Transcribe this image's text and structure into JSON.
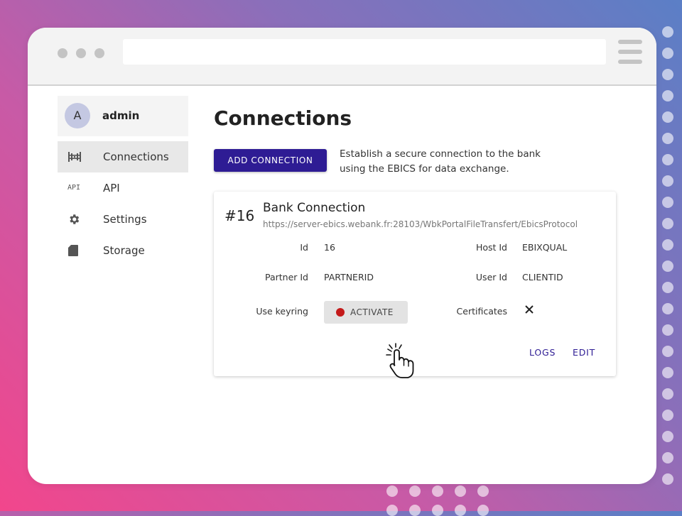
{
  "user": {
    "avatar_letter": "A",
    "name": "admin"
  },
  "nav": {
    "items": [
      {
        "label": "Connections",
        "icon": "connections-icon",
        "active": true
      },
      {
        "label": "API",
        "icon": "api-icon",
        "active": false
      },
      {
        "label": "Settings",
        "icon": "gear-icon",
        "active": false
      },
      {
        "label": "Storage",
        "icon": "sd-card-icon",
        "active": false
      }
    ],
    "api_icon_text": "API"
  },
  "page": {
    "title": "Connections",
    "add_button_label": "ADD CONNECTION",
    "description_line1": "Establish a secure connection to the bank",
    "description_line2": "using the EBICS for data exchange."
  },
  "connection": {
    "number": "#16",
    "title": "Bank Connection",
    "url": "https://server-ebics.webank.fr:28103/WbkPortalFileTransfert/EbicsProtocol",
    "fields": {
      "id_label": "Id",
      "id_value": "16",
      "host_id_label": "Host Id",
      "host_id_value": "EBIXQUAL",
      "partner_id_label": "Partner Id",
      "partner_id_value": "PARTNERID",
      "user_id_label": "User Id",
      "user_id_value": "CLIENTID",
      "use_keyring_label": "Use keyring",
      "certificates_label": "Certificates"
    },
    "activate_label": "ACTIVATE",
    "logs_label": "LOGS",
    "edit_label": "EDIT"
  },
  "colors": {
    "primary": "#2e1c94",
    "status_red": "#c41a1a"
  }
}
